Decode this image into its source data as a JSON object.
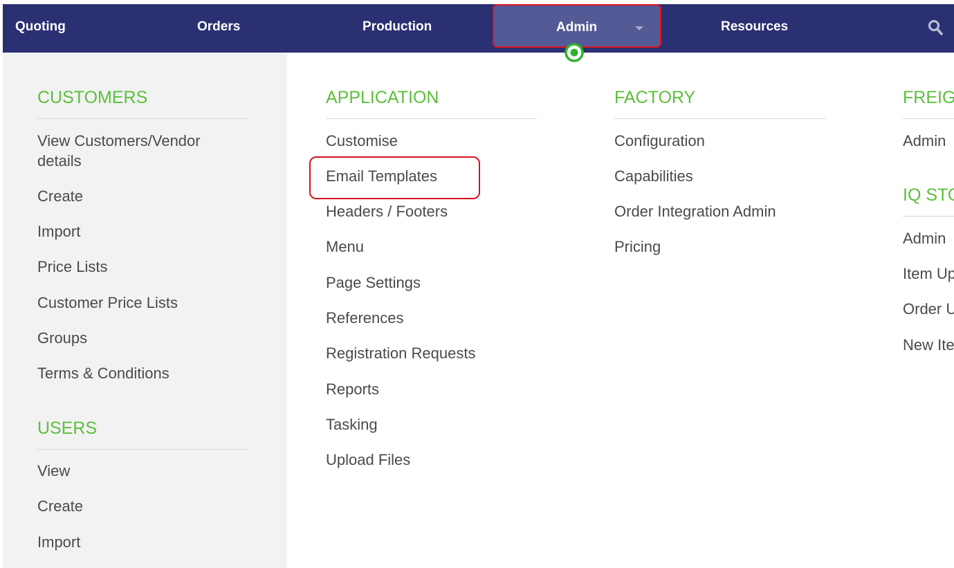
{
  "nav": {
    "items": [
      {
        "key": "quoting",
        "label": "Quoting"
      },
      {
        "key": "orders",
        "label": "Orders"
      },
      {
        "key": "production",
        "label": "Production"
      },
      {
        "key": "admin",
        "label": "Admin"
      },
      {
        "key": "resources",
        "label": "Resources"
      }
    ],
    "search_icon": "search-icon"
  },
  "menu": {
    "customers": {
      "heading": "CUSTOMERS",
      "items": [
        "View Customers/Vendor details",
        "Create",
        "Import",
        "Price Lists",
        "Customer Price Lists",
        "Groups",
        "Terms & Conditions"
      ]
    },
    "users": {
      "heading": "USERS",
      "items": [
        "View",
        "Create",
        "Import"
      ]
    },
    "application": {
      "heading": "APPLICATION",
      "items": [
        "Customise",
        "Email Templates",
        "Headers / Footers",
        "Menu",
        "Page Settings",
        "References",
        "Registration Requests",
        "Reports",
        "Tasking",
        "Upload Files"
      ]
    },
    "factory": {
      "heading": "FACTORY",
      "items": [
        "Configuration",
        "Capabilities",
        "Order Integration Admin",
        "Pricing"
      ]
    },
    "freight": {
      "heading": "FREIG",
      "items": [
        "Admin"
      ]
    },
    "iq_store": {
      "heading": "IQ STO",
      "items": [
        "Admin",
        "Item Up",
        "Order U",
        "New Ite"
      ]
    }
  },
  "colors": {
    "nav_bg": "#2b3072",
    "nav_active_bg": "#545a95",
    "accent_green": "#5cbf3c",
    "highlight_red": "#d4121e",
    "sidebar_bg": "#f2f2f2",
    "link_text": "#4a4a4a"
  }
}
